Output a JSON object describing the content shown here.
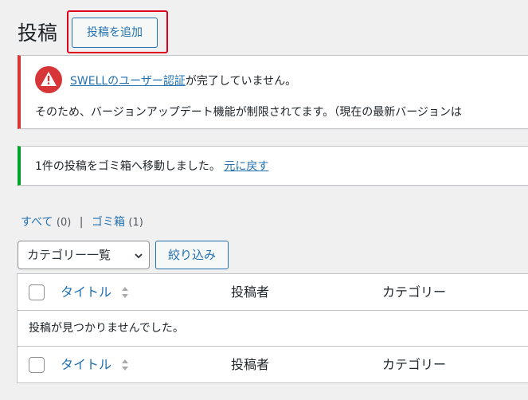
{
  "header": {
    "title": "投稿",
    "add_new_label": "投稿を追加"
  },
  "notices": {
    "error": {
      "link_text": "SWELLのユーザー認証",
      "line1_suffix": "が完了していません。",
      "line2": "そのため、バージョンアップデート機能が制限されてます。（現在の最新バージョンは"
    },
    "success": {
      "text": "1件の投稿をゴミ箱へ移動しました。",
      "undo_label": "元に戻す"
    }
  },
  "views": {
    "all_label": "すべて",
    "all_count": "(0)",
    "separator": "|",
    "trash_label": "ゴミ箱",
    "trash_count": "(1)"
  },
  "filters": {
    "category_selected": "カテゴリー一覧",
    "filter_button": "絞り込み"
  },
  "table": {
    "columns": {
      "title": "タイトル",
      "author": "投稿者",
      "category": "カテゴリー"
    },
    "empty_message": "投稿が見つかりませんでした。"
  },
  "colors": {
    "accent": "#2271b1",
    "error": "#d63638",
    "success": "#00a32a",
    "highlight": "#e0001b"
  },
  "icons": {
    "warning": "warning-icon",
    "chevron": "chevron-down-icon",
    "sort": "sort-icon"
  }
}
